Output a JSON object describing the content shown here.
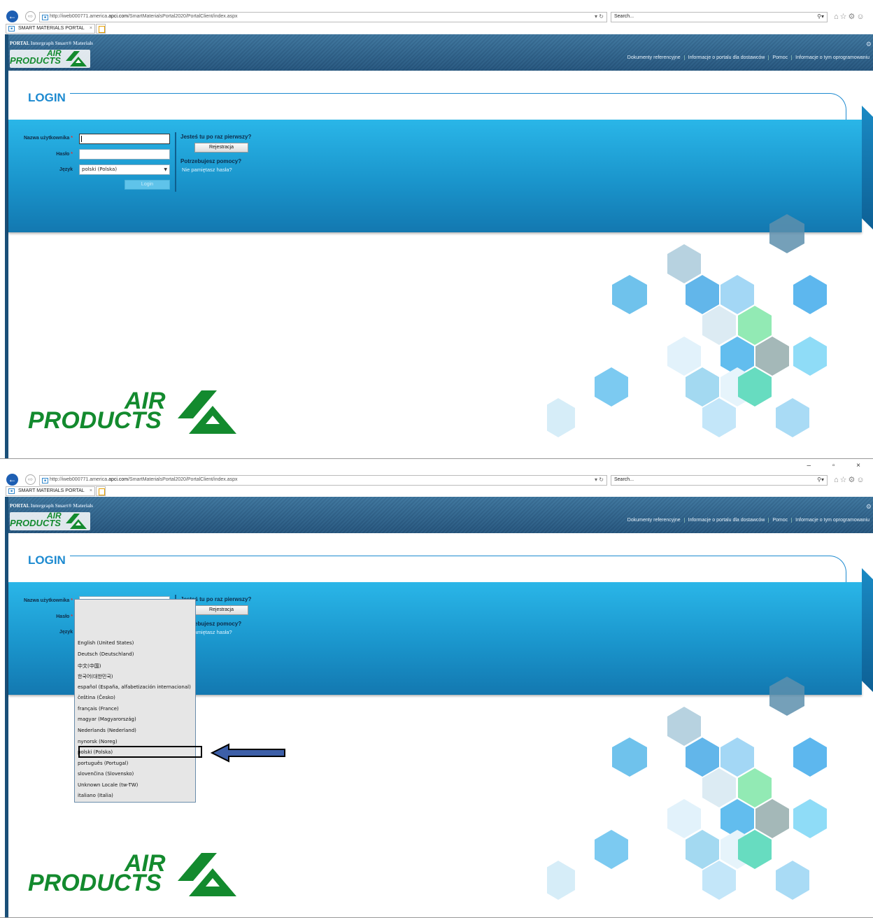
{
  "browser": {
    "url_prefix": "http://iweb000771.america.",
    "url_domain": "apci.com",
    "url_suffix": "/SmartMaterialsPortal2020/PortalClient/index.aspx",
    "search_placeholder": "Search...",
    "tab_title": "SMART MATERIALS PORTAL",
    "tab_close": "×"
  },
  "header": {
    "portal_label": "PORTAL",
    "product_name": "Intergraph Smart® Materials",
    "logo_air": "AIR",
    "logo_products": "PRODUCTS",
    "nav": [
      "Dokumenty referencyjne",
      "Informacje o portalu dla dostawców",
      "Pomoc",
      "Informacje o tym oprogramowaniu"
    ]
  },
  "login": {
    "title": "LOGIN",
    "username_label": "Nazwa użytkownika",
    "password_label": "Hasło",
    "language_label": "Język",
    "required_mark": "*",
    "language_value": "polski (Polska)",
    "login_button": "Login",
    "first_time_heading": "Jesteś tu po raz pierwszy?",
    "register_button": "Rejestracja",
    "help_heading": "Potrzebujesz pomocy?",
    "forgot_link": "Nie pamiętasz hasła?"
  },
  "dropdown_options": [
    "English (United States)",
    "Deutsch (Deutschland)",
    "中文(中国)",
    "한국어(대한민국)",
    "español (España, alfabetización internacional)",
    "čeština (Česko)",
    "français (France)",
    "magyar (Magyarország)",
    "Nederlands (Nederland)",
    "nynorsk (Noreg)",
    "polski (Polska)",
    "português (Portugal)",
    "slovenčina (Slovensko)",
    "Unknown Locale (tw-TW)",
    "italiano (Italia)"
  ],
  "colors": {
    "brand_green": "#138a2e",
    "band_blue": "#1a95cc",
    "title_blue": "#1d8ad0",
    "header_blue": "#2f5f85"
  }
}
